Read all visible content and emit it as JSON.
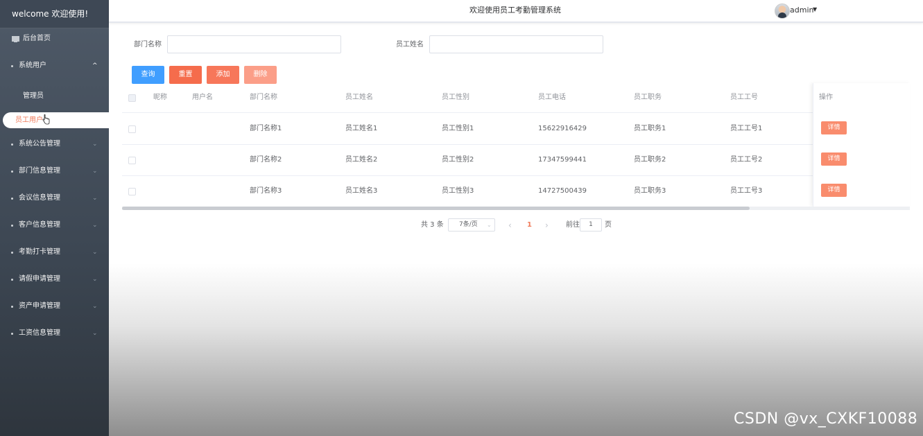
{
  "sidebar": {
    "welcome": "welcome 欢迎使用!",
    "home": "后台首页",
    "system_users": "系统用户",
    "admin": "管理员",
    "employee_users": "员工用户",
    "items": [
      "系统公告管理",
      "部门信息管理",
      "会议信息管理",
      "客户信息管理",
      "考勤打卡管理",
      "请假申请管理",
      "资产申请管理",
      "工资信息管理"
    ]
  },
  "header": {
    "title": "欢迎使用员工考勤管理系统",
    "user": "admin"
  },
  "search": {
    "dept_label": "部门名称",
    "name_label": "员工姓名",
    "dept_value": "",
    "name_value": ""
  },
  "buttons": {
    "query": "查询",
    "reset": "重置",
    "add": "添加",
    "delete": "删除"
  },
  "colors": {
    "query": "#409eff",
    "reset": "#f56c4c",
    "add": "#f7775a",
    "delete": "#fb9e88",
    "accent": "#f07a5a"
  },
  "table": {
    "headers": [
      "昵称",
      "用户名",
      "部门名称",
      "员工姓名",
      "员工性别",
      "员工电话",
      "员工职务",
      "员工工号",
      "操作"
    ],
    "rows": [
      {
        "nickname": "",
        "username": "",
        "dept": "部门名称1",
        "name": "员工姓名1",
        "gender": "员工性别1",
        "phone": "15622916429",
        "position": "员工职务1",
        "number": "员工工号1",
        "action": "详情"
      },
      {
        "nickname": "",
        "username": "",
        "dept": "部门名称2",
        "name": "员工姓名2",
        "gender": "员工性别2",
        "phone": "17347599441",
        "position": "员工职务2",
        "number": "员工工号2",
        "action": "详情"
      },
      {
        "nickname": "",
        "username": "",
        "dept": "部门名称3",
        "name": "员工姓名3",
        "gender": "员工性别3",
        "phone": "14727500439",
        "position": "员工职务3",
        "number": "员工工号3",
        "action": "详情"
      }
    ]
  },
  "pagination": {
    "total": "共 3 条",
    "page_size": "7条/页",
    "prev": "‹",
    "current": "1",
    "next": "›",
    "goto_label": "前往",
    "goto_value": "1",
    "page_suffix": "页"
  },
  "watermark": "CSDN @vx_CXKF10088"
}
